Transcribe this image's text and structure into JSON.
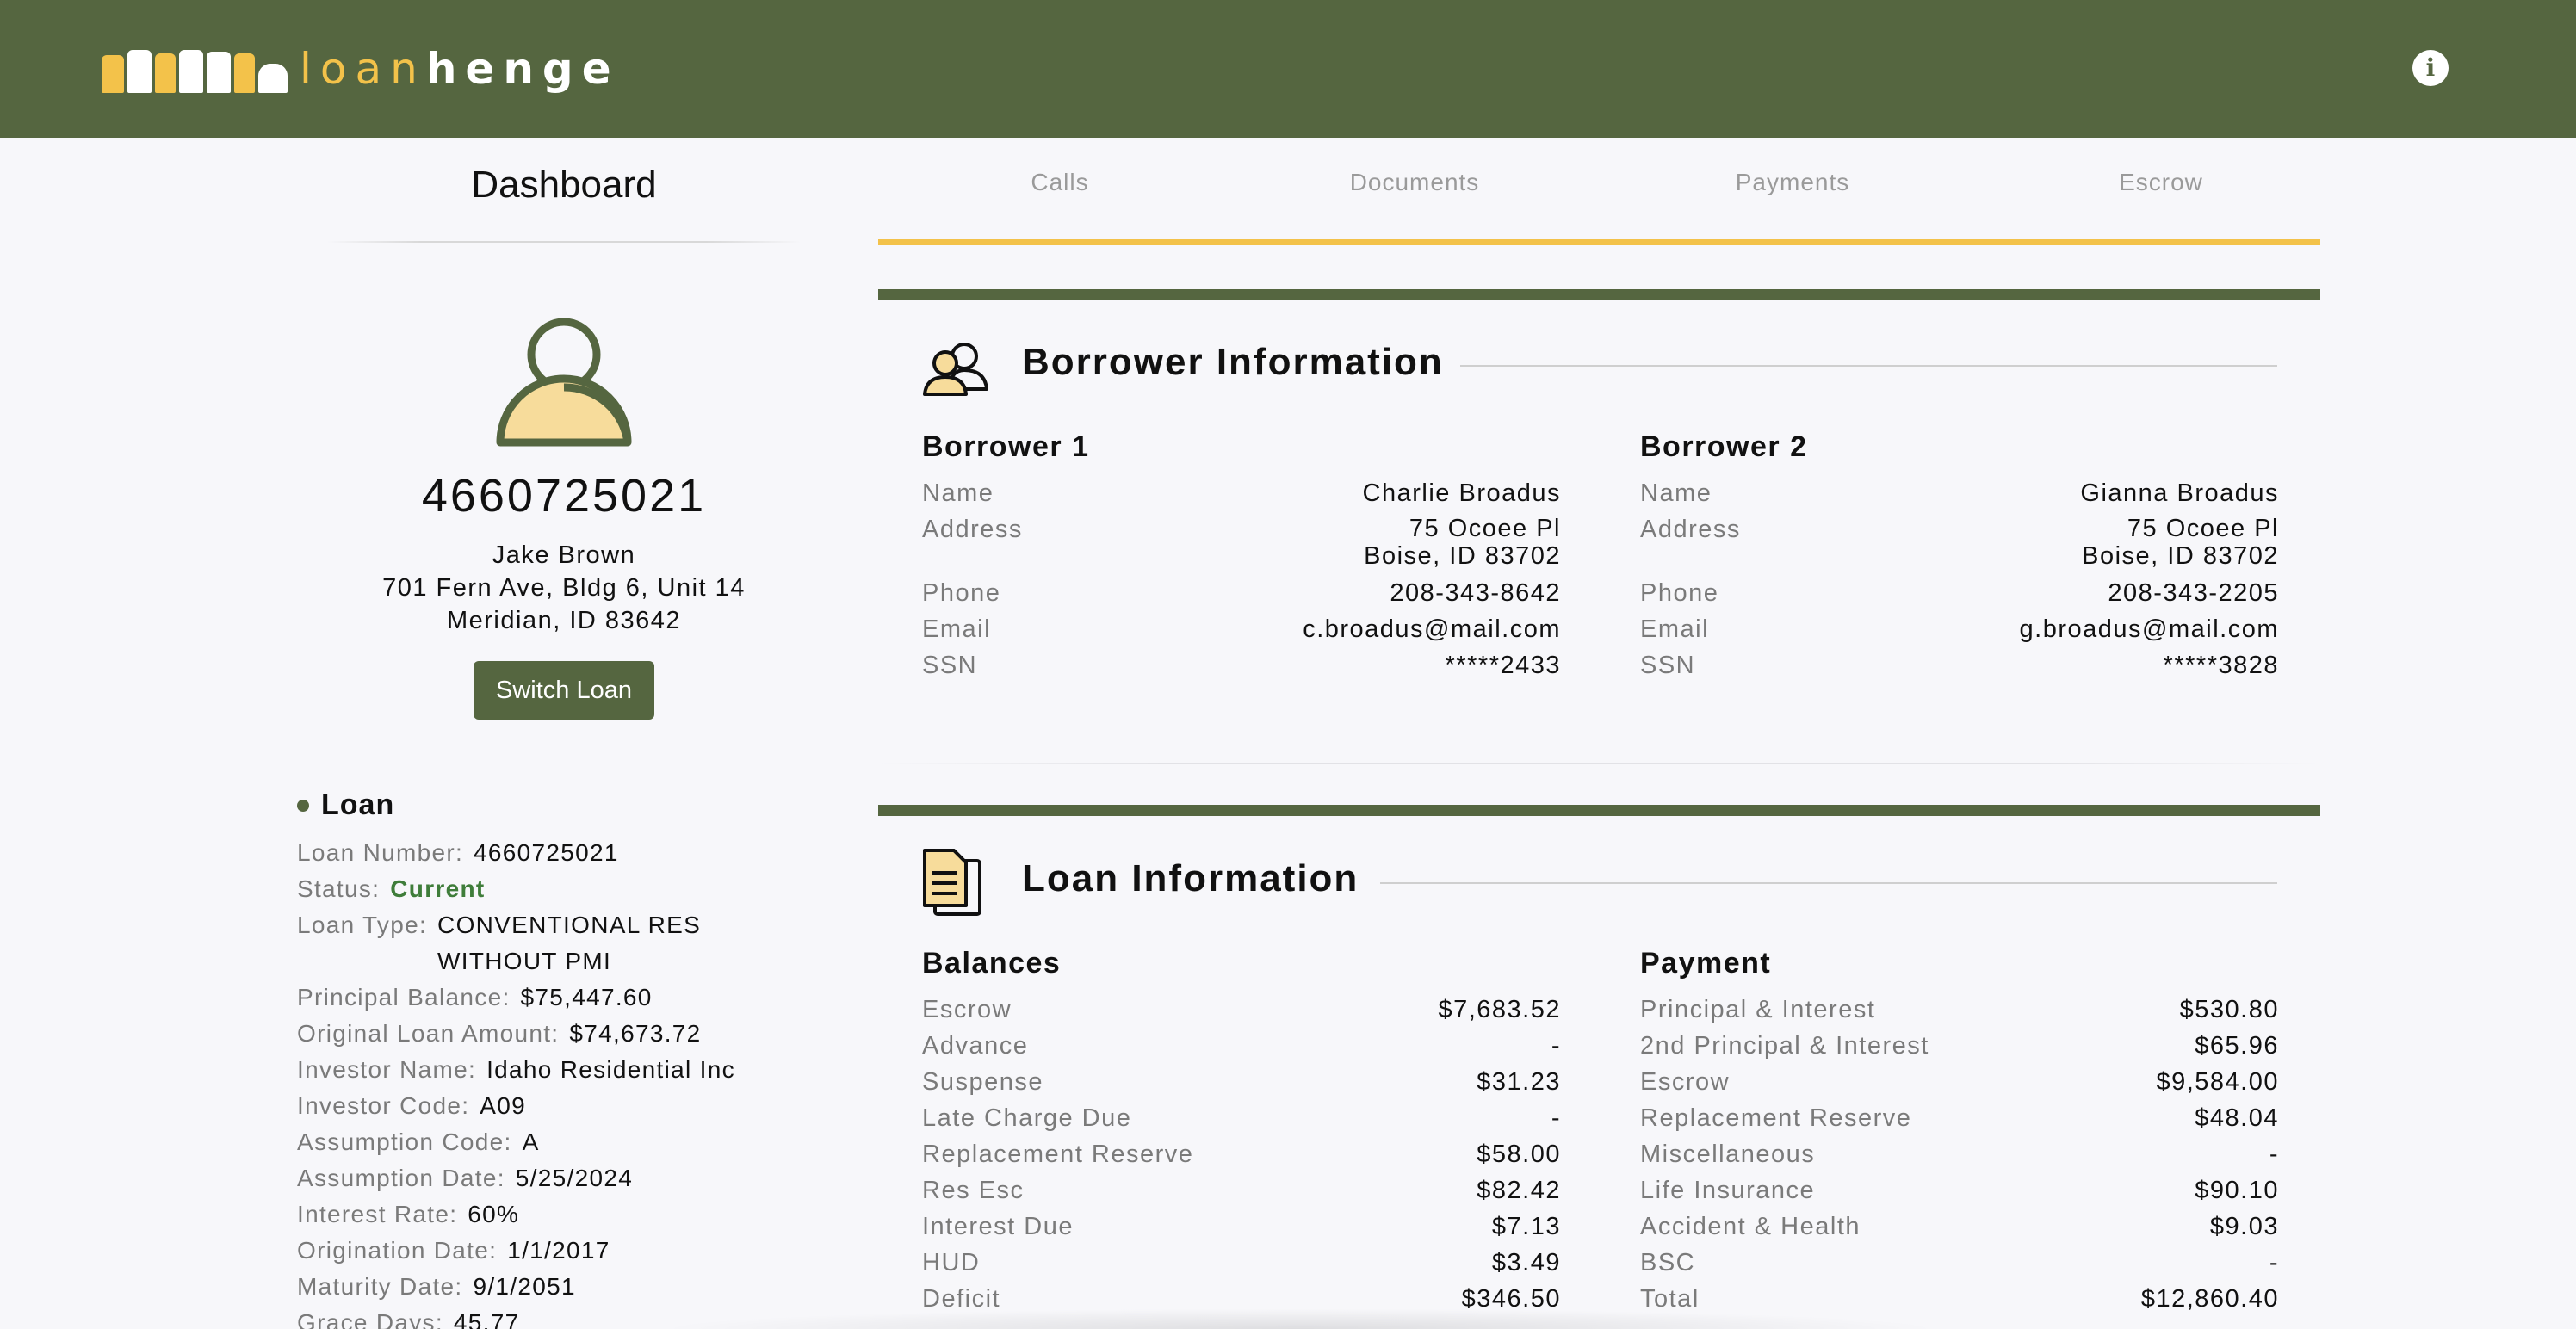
{
  "header": {
    "logo_text_a": "loan",
    "logo_text_b": "henge",
    "info_label": "i"
  },
  "sidebar": {
    "title": "Dashboard",
    "loan_id": "4660725021",
    "owner_name": "Jake Brown",
    "owner_address_1": "701 Fern Ave, Bldg 6, Unit 14",
    "owner_address_2": "Meridian, ID 83642",
    "switch_label": "Switch Loan",
    "loan_heading": "Loan",
    "loan_fields": [
      {
        "k": "Loan Number:",
        "v": "4660725021"
      },
      {
        "k": "Status:",
        "v": "Current"
      },
      {
        "k": "Loan Type:",
        "v": "CONVENTIONAL RES WITHOUT PMI"
      },
      {
        "k": "Principal Balance:",
        "v": "$75,447.60"
      },
      {
        "k": "Original Loan Amount:",
        "v": "$74,673.72"
      },
      {
        "k": "Investor Name:",
        "v": "Idaho Residential Inc"
      },
      {
        "k": "Investor Code:",
        "v": "A09"
      },
      {
        "k": "Assumption Code:",
        "v": "A"
      },
      {
        "k": "Assumption Date:",
        "v": "5/25/2024"
      },
      {
        "k": "Interest Rate:",
        "v": "60%"
      },
      {
        "k": "Origination Date:",
        "v": "1/1/2017"
      },
      {
        "k": "Maturity Date:",
        "v": "9/1/2051"
      },
      {
        "k": "Grace Days:",
        "v": "45.77"
      }
    ]
  },
  "tabs": [
    "Calls",
    "Documents",
    "Payments",
    "Escrow"
  ],
  "borrower_section": {
    "title": "Borrower Information",
    "b1": {
      "heading": "Borrower 1",
      "name_label": "Name",
      "name": "Charlie Broadus",
      "address_label": "Address",
      "address_1": "75 Ocoee Pl",
      "address_2": "Boise, ID 83702",
      "phone_label": "Phone",
      "phone": "208-343-8642",
      "email_label": "Email",
      "email": "c.broadus@mail.com",
      "ssn_label": "SSN",
      "ssn": "*****2433"
    },
    "b2": {
      "heading": "Borrower 2",
      "name_label": "Name",
      "name": "Gianna Broadus",
      "address_label": "Address",
      "address_1": "75 Ocoee Pl",
      "address_2": "Boise, ID 83702",
      "phone_label": "Phone",
      "phone": "208-343-2205",
      "email_label": "Email",
      "email": "g.broadus@mail.com",
      "ssn_label": "SSN",
      "ssn": "*****3828"
    }
  },
  "loan_section": {
    "title": "Loan Information",
    "balances_heading": "Balances",
    "balances": [
      {
        "k": "Escrow",
        "v": "$7,683.52"
      },
      {
        "k": "Advance",
        "v": "-"
      },
      {
        "k": "Suspense",
        "v": "$31.23"
      },
      {
        "k": "Late Charge Due",
        "v": "-"
      },
      {
        "k": "Replacement Reserve",
        "v": "$58.00"
      },
      {
        "k": "Res Esc",
        "v": "$82.42"
      },
      {
        "k": "Interest Due",
        "v": "$7.13"
      },
      {
        "k": "HUD",
        "v": "$3.49"
      },
      {
        "k": "Deficit",
        "v": "$346.50"
      }
    ],
    "payment_heading": "Payment",
    "payment": [
      {
        "k": "Principal & Interest",
        "v": "$530.80"
      },
      {
        "k": "2nd Principal & Interest",
        "v": "$65.96"
      },
      {
        "k": "Escrow",
        "v": "$9,584.00"
      },
      {
        "k": "Replacement Reserve",
        "v": "$48.04"
      },
      {
        "k": "Miscellaneous",
        "v": "-"
      },
      {
        "k": "Life Insurance",
        "v": "$90.10"
      },
      {
        "k": "Accident & Health",
        "v": "$9.03"
      },
      {
        "k": "BSC",
        "v": "-"
      },
      {
        "k": "Total",
        "v": "$12,860.40"
      }
    ]
  },
  "colors": {
    "brand_green": "#556640",
    "accent_yellow": "#f3c24a",
    "status_green": "#3f7d3a"
  },
  "icons": {
    "info": "info-icon",
    "avatar": "user-avatar-icon",
    "borrowers": "users-icon",
    "loan": "documents-icon"
  }
}
